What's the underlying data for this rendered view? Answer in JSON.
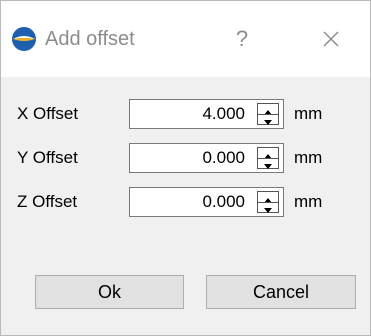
{
  "window": {
    "title": "Add offset",
    "help_label": "?",
    "icon": "app-logo-icon",
    "close_icon": "close-icon"
  },
  "fields": [
    {
      "label": "X Offset",
      "value": "4.000",
      "unit": "mm"
    },
    {
      "label": "Y Offset",
      "value": "0.000",
      "unit": "mm"
    },
    {
      "label": "Z Offset",
      "value": "0.000",
      "unit": "mm"
    }
  ],
  "buttons": {
    "ok": "Ok",
    "cancel": "Cancel"
  },
  "colors": {
    "logo_blue": "#1f5fb0",
    "logo_yellow": "#f2b01e",
    "title_gray": "#8c8c8c",
    "dialog_bg": "#f0f0f0"
  }
}
